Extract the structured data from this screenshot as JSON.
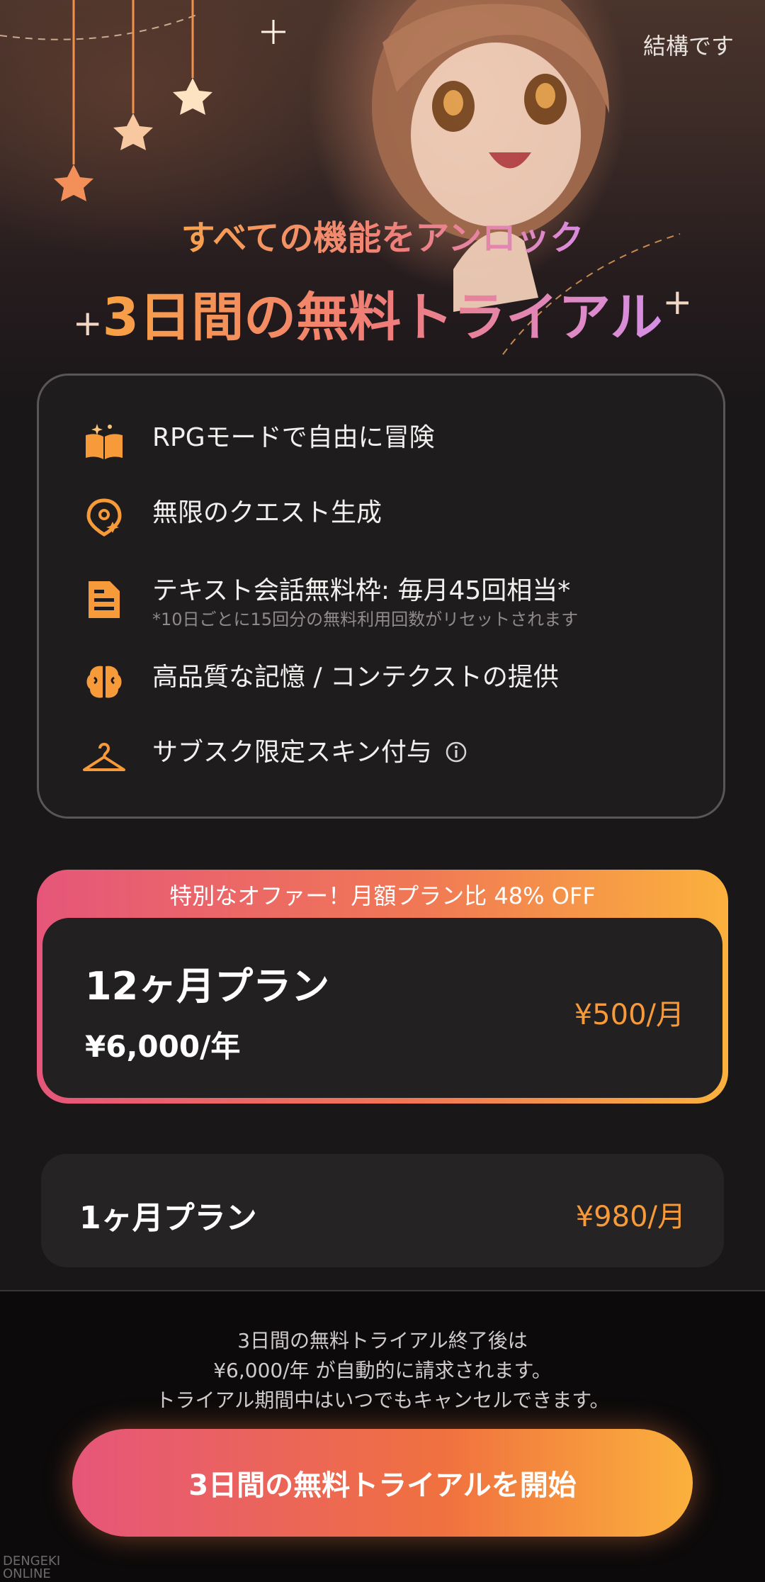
{
  "header": {
    "skip_label": "結構です"
  },
  "hero": {
    "subtitle": "すべての機能をアンロック",
    "title": "3日間の無料トライアル"
  },
  "features": [
    {
      "label": "RPGモードで自由に冒険",
      "icon": "book-icon"
    },
    {
      "label": "無限のクエスト生成",
      "icon": "quest-pin-icon"
    },
    {
      "label": "テキスト会話無料枠: 毎月45回相当*",
      "note": "*10日ごとに15回分の無料利用回数がリセットされます",
      "icon": "document-icon"
    },
    {
      "label": "高品質な記憶 / コンテクストの提供",
      "icon": "brain-icon"
    },
    {
      "label": "サブスク限定スキン付与",
      "icon": "hanger-icon"
    }
  ],
  "plans": {
    "annual": {
      "banner": "特別なオファー！月額プラン比 48% OFF",
      "name": "12ヶ月プラン",
      "yearly_price": "¥6,000/年",
      "monthly_price": "¥500/月"
    },
    "monthly": {
      "name": "1ヶ月プラン",
      "price": "¥980/月"
    }
  },
  "footer": {
    "info_line1": "3日間の無料トライアル終了後は",
    "info_line2": "¥6,000/年 が自動的に請求されます。",
    "info_line3": "トライアル期間中はいつでもキャンセルできます。",
    "cta_label": "3日間の無料トライアルを開始",
    "watermark_line1": "DENGEKI",
    "watermark_line2": "ONLINE"
  },
  "colors": {
    "accent_orange": "#f79a3a",
    "gradient_pink": "#e6567a",
    "gradient_yellow": "#fbb13d",
    "background": "#1a1719"
  }
}
